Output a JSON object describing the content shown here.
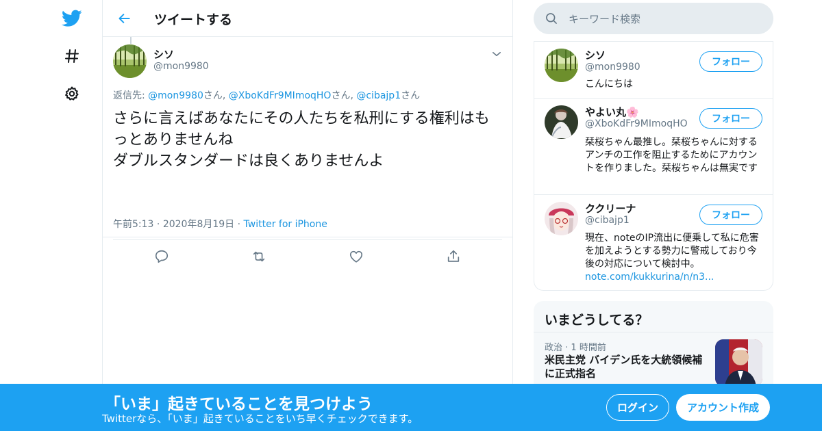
{
  "colors": {
    "accent": "#1da1f2",
    "link": "#1b95e0",
    "muted": "#657786",
    "border": "#e6ecf0"
  },
  "nav": {
    "items": [
      {
        "icon": "twitter-logo-icon"
      },
      {
        "icon": "hashtag-icon"
      },
      {
        "icon": "gear-icon"
      }
    ]
  },
  "header": {
    "title": "ツイートする"
  },
  "tweet": {
    "author_name": "シソ",
    "author_handle": "@mon9980",
    "reply_label": "返信先: ",
    "mentions": [
      {
        "handle": "@mon9980",
        "suffix": "さん, "
      },
      {
        "handle": "@XboKdFr9MImoqHO",
        "suffix": "さん, "
      },
      {
        "handle": "@cibajp1",
        "suffix": "さん"
      }
    ],
    "text": "さらに言えばあなたにその人たちを私刑にする権利はもっとありませんね\nダブルスタンダードは良くありませんよ",
    "time": "午前5:13",
    "date": "2020年8月19日",
    "source": "Twitter for iPhone",
    "actions": [
      "reply-icon",
      "retweet-icon",
      "like-icon",
      "share-icon"
    ]
  },
  "search": {
    "placeholder": "キーワード検索"
  },
  "users": [
    {
      "name": "シソ",
      "handle": "@mon9980",
      "bio": "こんにちは",
      "bio_link": "",
      "follow": "フォロー"
    },
    {
      "name": "やよい丸🌸",
      "handle": "@XboKdFr9MImoqHO",
      "bio": "栞桜ちゃん最推し。栞桜ちゃんに対するアンチの工作を阻止するためにアカウントを作りました。栞桜ちゃんは無実です",
      "bio_link": "",
      "follow": "フォロー"
    },
    {
      "name": "ククリーナ",
      "handle": "@cibajp1",
      "bio": "現在、noteのIP流出に便乗して私に危害を加えようとする勢力に警戒しており今後の対応について検討中。",
      "bio_link": "note.com/kukkurina/n/n3...",
      "follow": "フォロー"
    }
  ],
  "trends": {
    "title": "いまどうしてる？",
    "item": {
      "category": "政治",
      "time": "1 時間前",
      "headline": "米民主党 バイデン氏を大統領候補に正式指名"
    }
  },
  "banner": {
    "title": "「いま」起きていることを見つけよう",
    "subtitle": "Twitterなら、「いま」起きていることをいち早くチェックできます。",
    "login": "ログイン",
    "signup": "アカウント作成"
  }
}
